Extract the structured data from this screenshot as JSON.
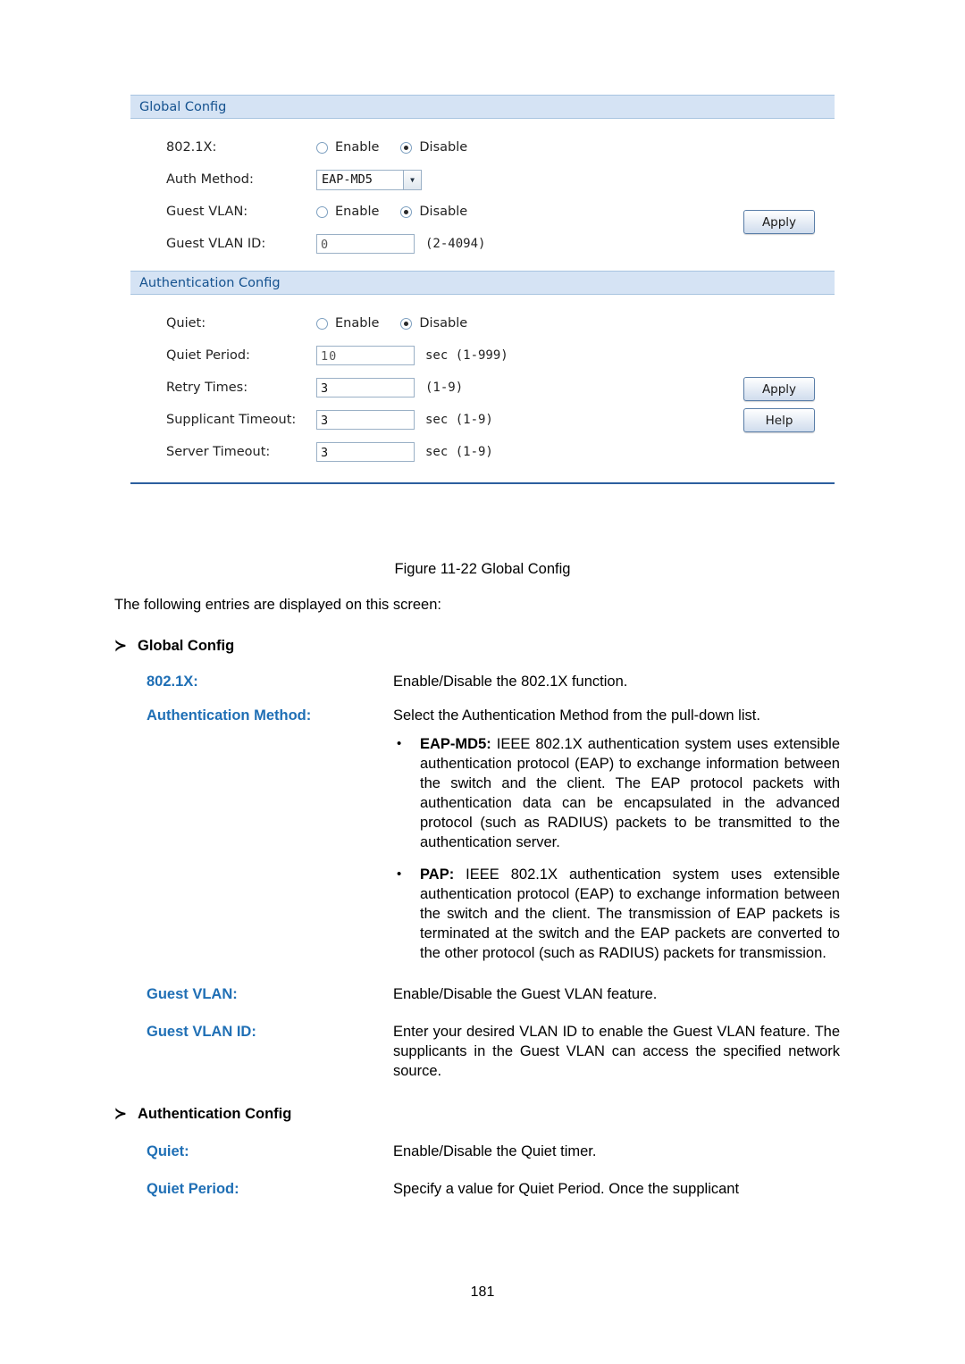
{
  "screenshot": {
    "global_config": {
      "header": "Global Config",
      "rows": {
        "dot1x_label": "802.1X:",
        "dot1x_enable": "Enable",
        "dot1x_disable": "Disable",
        "auth_method_label": "Auth Method:",
        "auth_method_value": "EAP-MD5",
        "guest_vlan_label": "Guest VLAN:",
        "guest_vlan_enable": "Enable",
        "guest_vlan_disable": "Disable",
        "guest_vlan_id_label": "Guest VLAN ID:",
        "guest_vlan_id_value": "0",
        "guest_vlan_id_hint": "(2-4094)"
      },
      "apply_label": "Apply"
    },
    "auth_config": {
      "header": "Authentication Config",
      "rows": {
        "quiet_label": "Quiet:",
        "quiet_enable": "Enable",
        "quiet_disable": "Disable",
        "quiet_period_label": "Quiet Period:",
        "quiet_period_value": "10",
        "quiet_period_hint": "sec (1-999)",
        "retry_times_label": "Retry Times:",
        "retry_times_value": "3",
        "retry_times_hint": "(1-9)",
        "supplicant_timeout_label": "Supplicant Timeout:",
        "supplicant_timeout_value": "3",
        "supplicant_timeout_hint": "sec (1-9)",
        "server_timeout_label": "Server Timeout:",
        "server_timeout_value": "3",
        "server_timeout_hint": "sec (1-9)"
      },
      "apply_label": "Apply",
      "help_label": "Help"
    }
  },
  "document": {
    "figure_caption": "Figure 11-22 Global Config",
    "intro": "The following entries are displayed on this screen:",
    "section1": {
      "arrow": "≻",
      "title": "Global Config",
      "entries": [
        {
          "term": "802.1X:",
          "desc": "Enable/Disable the 802.1X function."
        },
        {
          "term": "Authentication Method:",
          "desc": "Select the Authentication Method from the pull-down list."
        },
        {
          "term": "Guest VLAN:",
          "desc": "Enable/Disable the Guest VLAN feature."
        },
        {
          "term": "Guest VLAN ID:",
          "desc": "Enter your desired VLAN ID to enable the Guest VLAN feature. The supplicants in the Guest VLAN can access the specified network source."
        }
      ],
      "bullets": [
        {
          "dot": "•",
          "bold": "EAP-MD5:",
          "text": " IEEE 802.1X authentication system uses extensible authentication protocol (EAP) to exchange information between the switch and the client. The EAP protocol packets with authentication data can be encapsulated in the advanced protocol (such as RADIUS) packets to be transmitted to the authentication server."
        },
        {
          "dot": "•",
          "bold": "PAP:",
          "text": " IEEE 802.1X authentication system uses extensible authentication protocol (EAP) to exchange information between the switch and the client. The transmission of EAP packets is terminated at the switch and the EAP packets are converted to the other protocol (such as RADIUS) packets for transmission."
        }
      ]
    },
    "section2": {
      "arrow": "≻",
      "title": "Authentication Config",
      "entries": [
        {
          "term": "Quiet:",
          "desc": "Enable/Disable the Quiet timer."
        },
        {
          "term": "Quiet Period:",
          "desc": "Specify a value for Quiet Period. Once the supplicant"
        }
      ]
    },
    "page_number": "181"
  }
}
